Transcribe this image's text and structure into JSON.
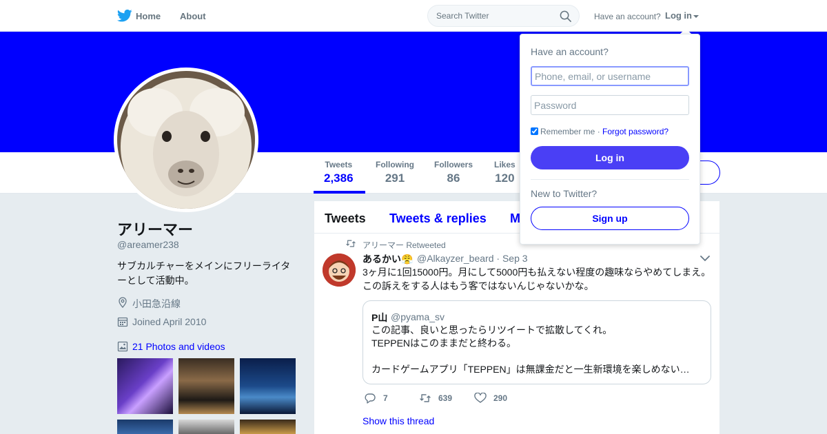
{
  "nav": {
    "home_label": "Home",
    "about_label": "About",
    "search_placeholder": "Search Twitter",
    "have_account": "Have an account?",
    "login_label": "Log in"
  },
  "profile": {
    "stats": [
      {
        "label": "Tweets",
        "value": "2,386"
      },
      {
        "label": "Following",
        "value": "291"
      },
      {
        "label": "Followers",
        "value": "86"
      },
      {
        "label": "Likes",
        "value": "120"
      }
    ],
    "name": "アリーマー",
    "handle": "@areamer238",
    "bio": "サブカルチャーをメインにフリーライターとして活動中。",
    "location": "小田急沿線",
    "joined": "Joined April 2010",
    "photos_label": "21 Photos and videos"
  },
  "timeline": {
    "tabs": [
      "Tweets",
      "Tweets & replies",
      "M"
    ],
    "tweet": {
      "retweeted_by": "アリーマー Retweeted",
      "author_name": "あるかい😤",
      "author_handle": "@Alkayzer_beard",
      "date": "· Sep 3",
      "text": "3ヶ月に1回15000円。月にして5000円も払えない程度の趣味ならやめてしまえ。この訴えをする人はもう客ではないんじゃないかな。",
      "quote": {
        "name": "P山",
        "handle": "@pyama_sv",
        "text": "この記事、良いと思ったらリツイートで拡散してくれ。\nTEPPENはこのままだと終わる。\n\nカードゲームアプリ「TEPPEN」は無課金だと一生新環境を楽しめない…"
      },
      "replies": "7",
      "retweets": "639",
      "likes": "290",
      "show_thread": "Show this thread"
    }
  },
  "login_dropdown": {
    "title": "Have an account?",
    "username_placeholder": "Phone, email, or username",
    "password_placeholder": "Password",
    "remember_me": "Remember me",
    "separator": " · ",
    "forgot_password": "Forgot password?",
    "login_button": "Log in",
    "new_to_twitter": "New to Twitter?",
    "signup_button": "Sign up"
  },
  "colors": {
    "brand": "#0000ff",
    "banner": "#0000ff",
    "login_button": "#4a3ff5",
    "muted_text": "#657786",
    "page_bg": "#e6ecf0"
  }
}
